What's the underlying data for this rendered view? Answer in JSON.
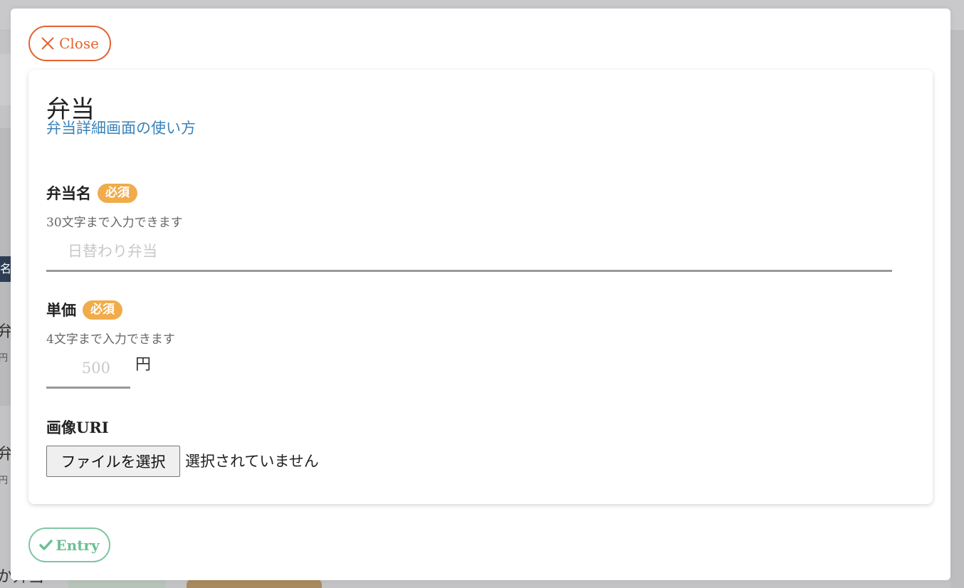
{
  "modal": {
    "close_label": "Close",
    "entry_label": "Entry",
    "title": "弁当",
    "help_link": "弁当詳細画面の使い方"
  },
  "fields": {
    "name": {
      "label": "弁当名",
      "required_badge": "必須",
      "hint": "30文字まで入力できます",
      "value": "",
      "placeholder": "日替わり弁当"
    },
    "price": {
      "label": "単価",
      "required_badge": "必須",
      "hint": "4文字まで入力できます",
      "value": "",
      "placeholder": "500",
      "unit": "円"
    },
    "image": {
      "label": "画像URI",
      "file_button": "ファイルを選択",
      "file_status": "選択されていません"
    }
  },
  "background": {
    "fragments": [
      "弁",
      "円",
      "弁",
      "円",
      "か弁当",
      "名"
    ]
  },
  "colors": {
    "close_accent": "#e2622e",
    "entry_accent": "#7ec6a2",
    "required_badge": "#f0ac4a",
    "link": "#3b82b8"
  },
  "icons": {
    "close": "close-icon",
    "entry": "check-icon"
  }
}
